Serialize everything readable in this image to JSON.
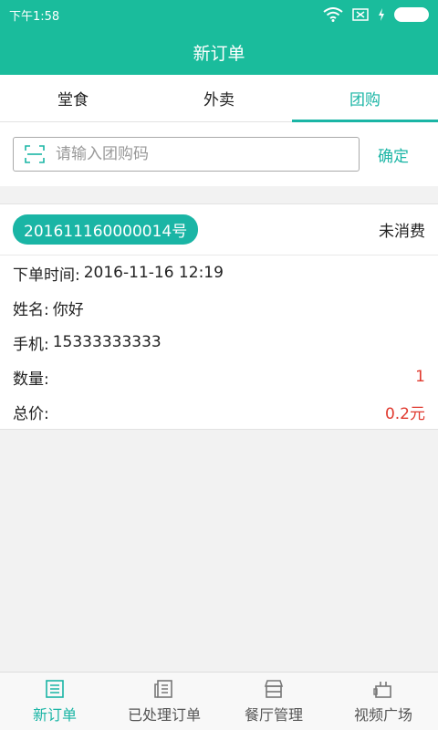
{
  "status_bar": {
    "time": "下午1:58"
  },
  "header": {
    "title": "新订单"
  },
  "tabs": [
    {
      "label": "堂食",
      "active": false
    },
    {
      "label": "外卖",
      "active": false
    },
    {
      "label": "团购",
      "active": true
    }
  ],
  "search": {
    "placeholder": "请输入团购码",
    "value": "",
    "confirm_label": "确定"
  },
  "order": {
    "number": "201611160000014号",
    "status": "未消费",
    "order_time_label": "下单时间:",
    "order_time": "2016-11-16 12:19",
    "name_label": "姓名:",
    "name": "你好",
    "phone_label": "手机:",
    "phone": "15333333333",
    "quantity_label": "数量:",
    "quantity": "1",
    "total_label": "总价:",
    "total": "0.2元"
  },
  "bottom_nav": [
    {
      "label": "新订单",
      "icon": "list-icon",
      "active": true
    },
    {
      "label": "已处理订单",
      "icon": "document-icon",
      "active": false
    },
    {
      "label": "餐厅管理",
      "icon": "store-icon",
      "active": false
    },
    {
      "label": "视频广场",
      "icon": "video-icon",
      "active": false
    }
  ],
  "colors": {
    "primary": "#1abc9c",
    "accent": "#1ab5a5",
    "price": "#e03a2f"
  }
}
